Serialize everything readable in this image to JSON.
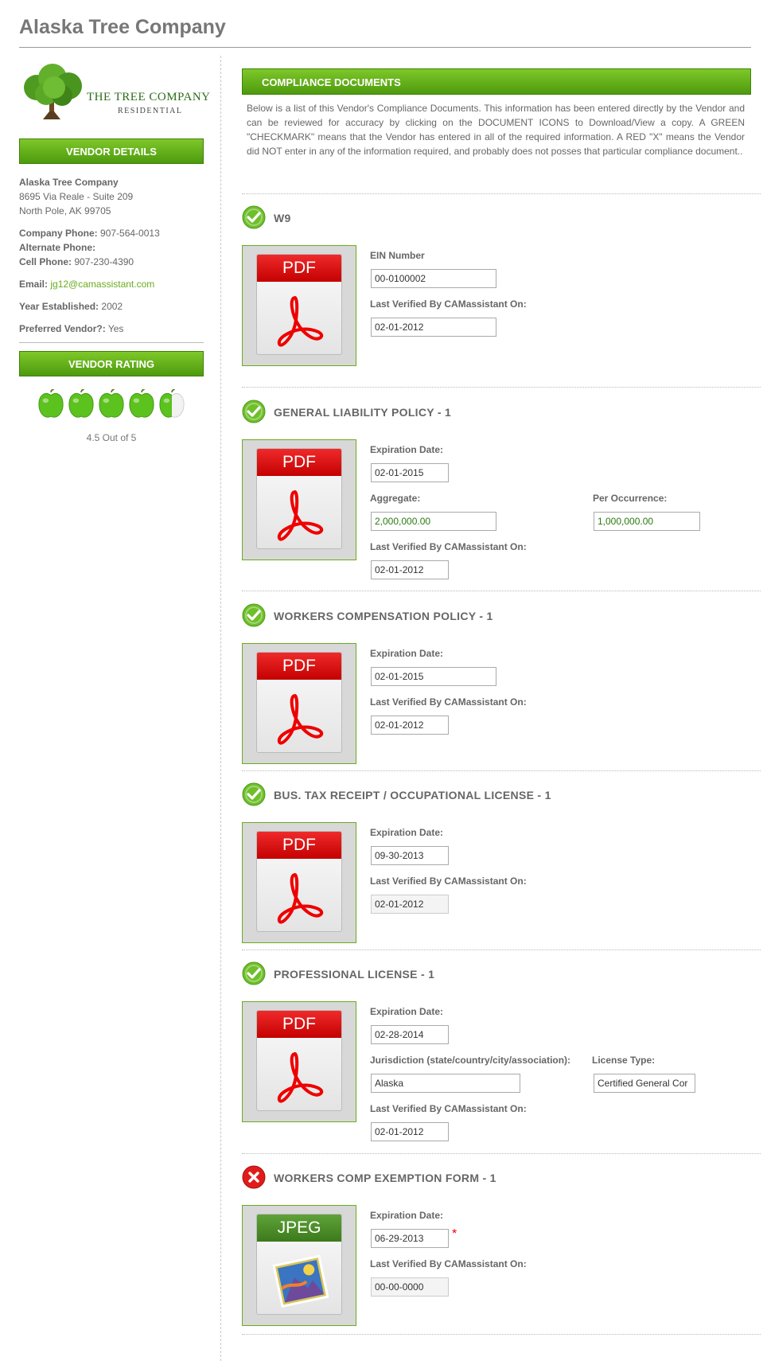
{
  "page": {
    "title": "Alaska Tree Company"
  },
  "sidebar": {
    "logo": {
      "line1": "THE TREE COMPANY",
      "line2": "RESIDENTIAL"
    },
    "vendor_details_heading": "VENDOR DETAILS",
    "company_name": "Alaska Tree Company",
    "address_line1": "8695 Via Reale - Suite 209",
    "address_line2": "North Pole, AK 99705",
    "company_phone_label": "Company Phone:",
    "company_phone": "907-564-0013",
    "alternate_phone_label": "Alternate Phone:",
    "alternate_phone": "",
    "cell_phone_label": "Cell Phone:",
    "cell_phone": "907-230-4390",
    "email_label": "Email:",
    "email": "jg12@camassistant.com",
    "year_label": "Year Established:",
    "year": "2002",
    "preferred_label": "Preferred Vendor?:",
    "preferred": "Yes",
    "rating_heading": "VENDOR RATING",
    "rating_value": 4.5,
    "rating_max": 5,
    "rating_text": "4.5 Out of 5",
    "apple_color": "#5cc21d"
  },
  "main": {
    "heading": "COMPLIANCE DOCUMENTS",
    "intro": "Below is a list of this Vendor's Compliance Documents. This information has been entered directly by the Vendor and can be reviewed for accuracy by clicking on the DOCUMENT ICONS to Download/View a copy. A GREEN \"CHECKMARK\" means that the Vendor has entered in all of the required information. A RED \"X\" means the Vendor did NOT enter in any of the information required, and probably does not posses that particular compliance document.."
  },
  "colors": {
    "accent_green": "#5ba614",
    "check_green": "#6fbf2a",
    "error_red": "#e01b1b"
  },
  "documents": {
    "w9": {
      "title": "W9",
      "status": "complete",
      "file_type": "PDF",
      "ein_label": "EIN Number",
      "ein": "00-0100002",
      "verified_label": "Last Verified By CAMassistant On:",
      "verified": "02-01-2012"
    },
    "gl": {
      "title": "GENERAL LIABILITY POLICY - 1",
      "status": "complete",
      "file_type": "PDF",
      "exp_label": "Expiration Date:",
      "exp": "02-01-2015",
      "aggregate_label": "Aggregate:",
      "aggregate": "2,000,000.00",
      "per_occ_label": "Per Occurrence:",
      "per_occ": "1,000,000.00",
      "verified_label": "Last Verified By CAMassistant On:",
      "verified": "02-01-2012"
    },
    "wc": {
      "title": "WORKERS COMPENSATION POLICY - 1",
      "status": "complete",
      "file_type": "PDF",
      "exp_label": "Expiration Date:",
      "exp": "02-01-2015",
      "verified_label": "Last Verified By CAMassistant On:",
      "verified": "02-01-2012"
    },
    "btr": {
      "title": "BUS. TAX RECEIPT / OCCUPATIONAL LICENSE - 1",
      "status": "complete",
      "file_type": "PDF",
      "exp_label": "Expiration Date:",
      "exp": "09-30-2013",
      "verified_label": "Last Verified By CAMassistant On:",
      "verified": "02-01-2012"
    },
    "pl": {
      "title": "PROFESSIONAL LICENSE - 1",
      "status": "complete",
      "file_type": "PDF",
      "exp_label": "Expiration Date:",
      "exp": "02-28-2014",
      "jurisdiction_label": "Jurisdiction (state/country/city/association):",
      "jurisdiction": "Alaska",
      "license_type_label": "License Type:",
      "license_type": "Certified General Cor",
      "verified_label": "Last Verified By CAMassistant On:",
      "verified": "02-01-2012"
    },
    "wce": {
      "title": "WORKERS COMP EXEMPTION FORM - 1",
      "status": "incomplete",
      "file_type": "JPEG",
      "exp_label": "Expiration Date:",
      "exp": "06-29-2013",
      "required_mark": "*",
      "verified_label": "Last Verified By CAMassistant On:",
      "verified": "00-00-0000"
    }
  }
}
